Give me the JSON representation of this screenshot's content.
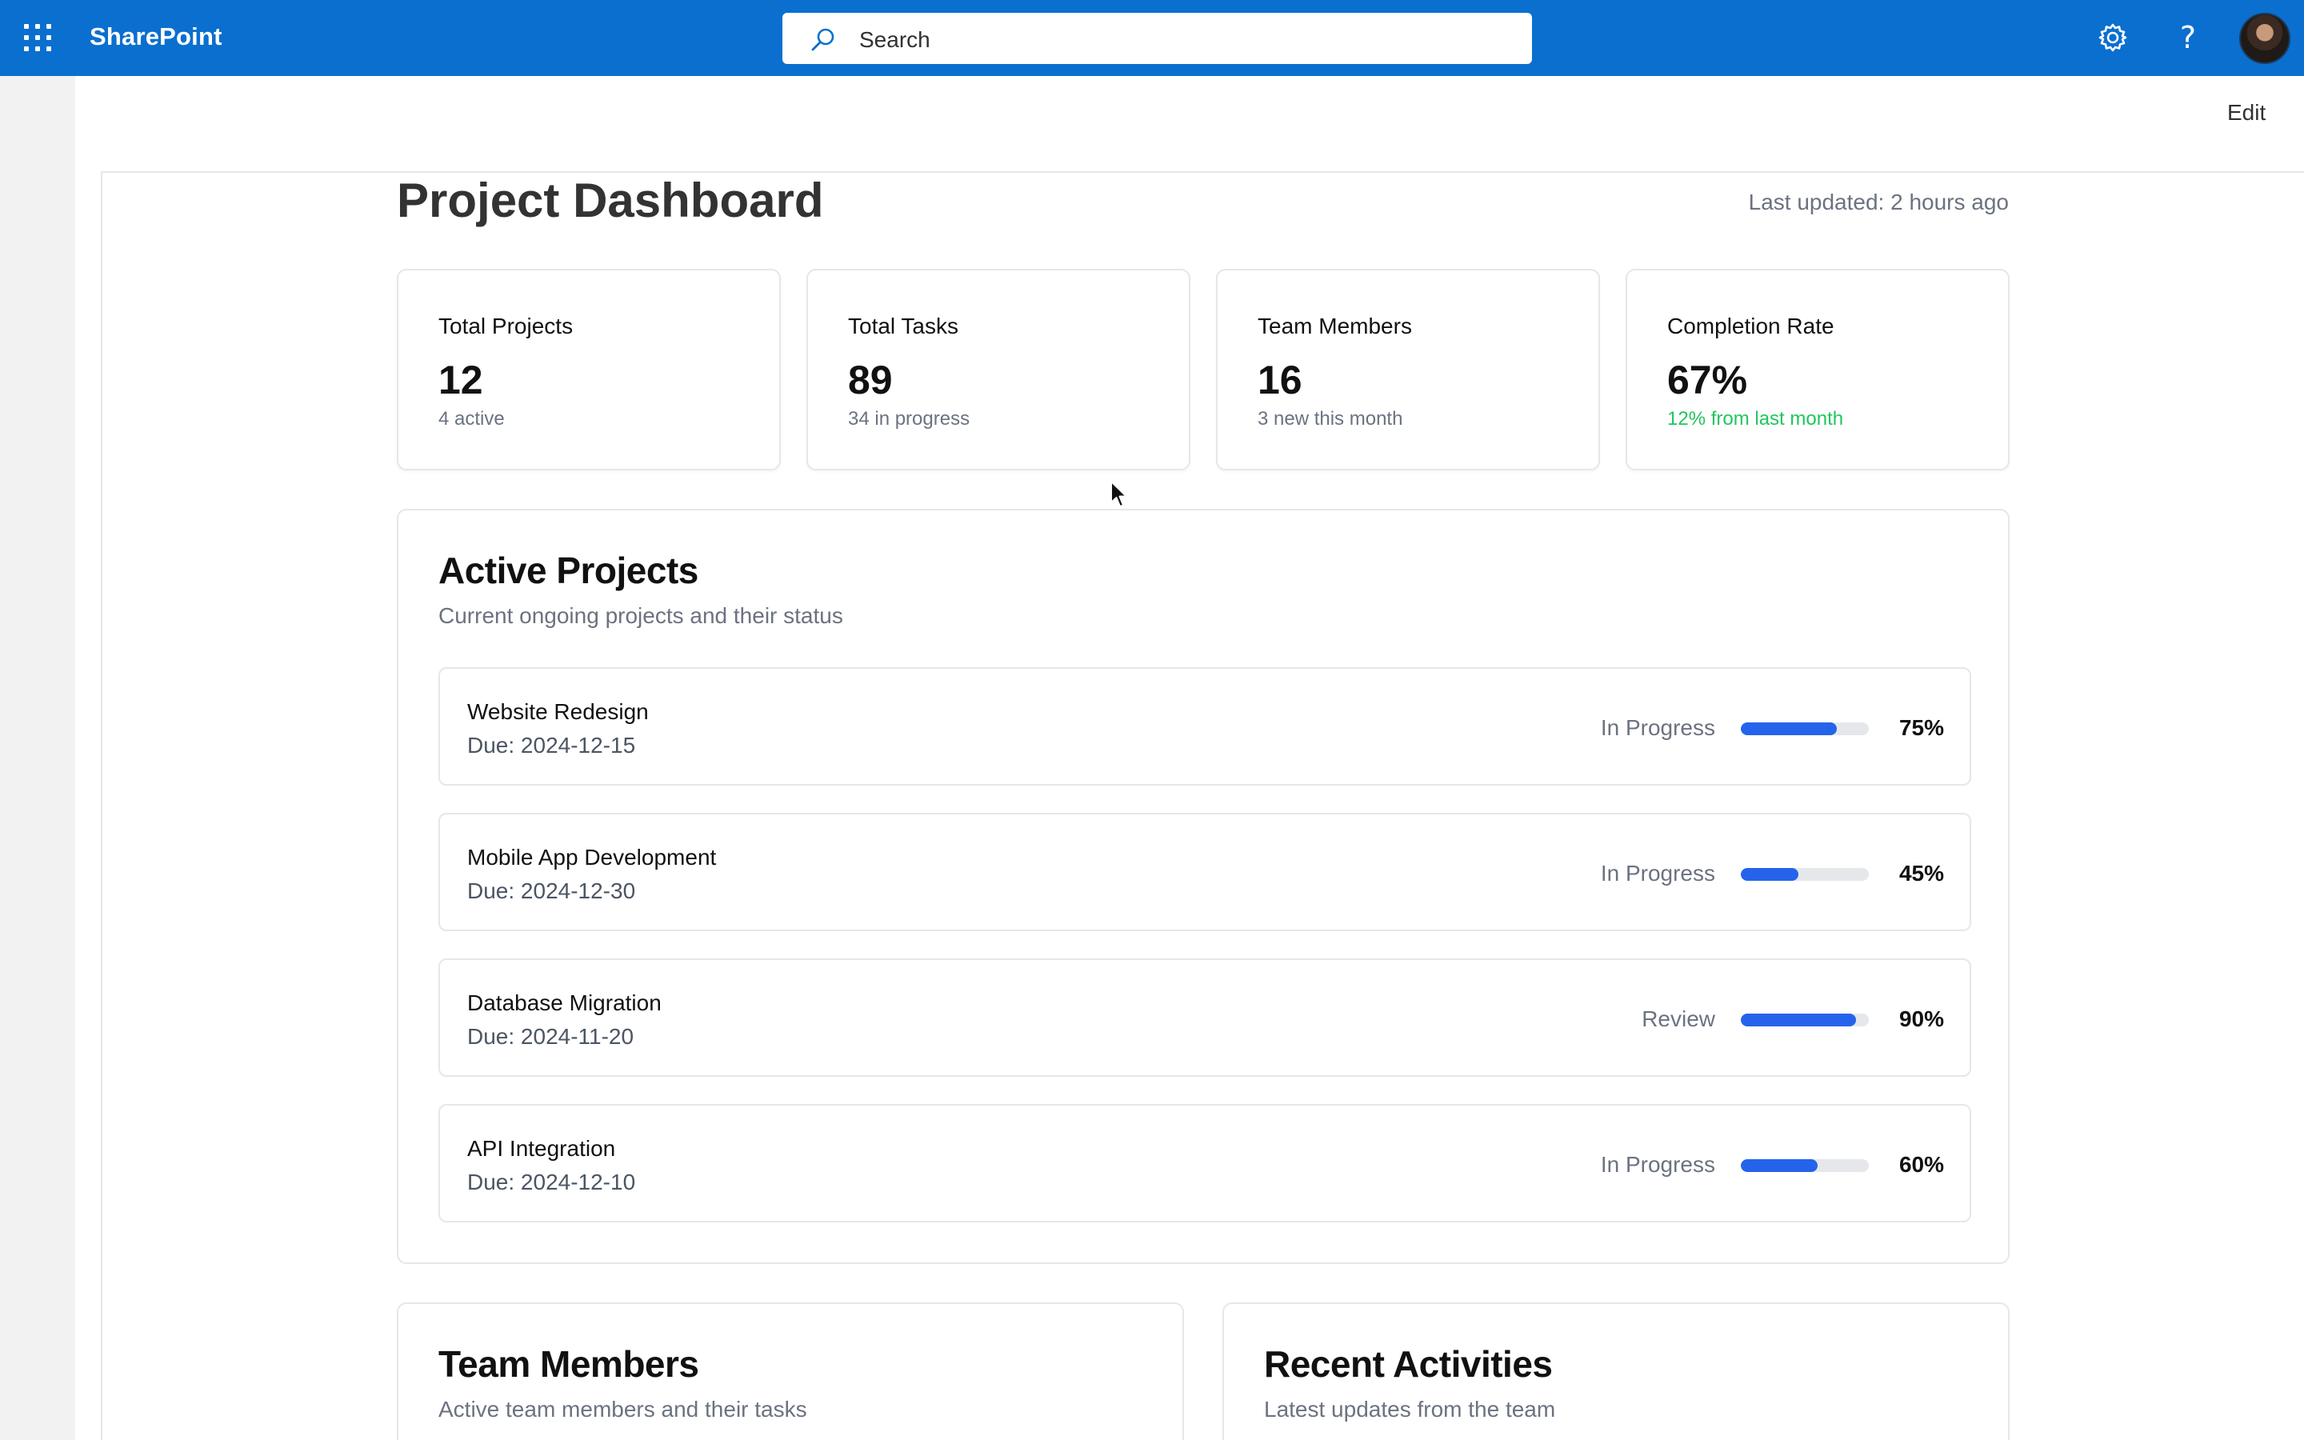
{
  "header": {
    "brand": "SharePoint",
    "search_placeholder": "Search",
    "help_glyph": "?",
    "icons": [
      "app-launcher-icon",
      "search-icon",
      "gear-icon",
      "help-icon"
    ],
    "accent_color": "#0a6fcf"
  },
  "page": {
    "edit_label": "Edit",
    "title": "Project Dashboard",
    "last_updated": "Last updated: 2 hours ago"
  },
  "stats": [
    {
      "label": "Total Projects",
      "value": "12",
      "sub": "4 active"
    },
    {
      "label": "Total Tasks",
      "value": "89",
      "sub": "34 in progress"
    },
    {
      "label": "Team Members",
      "value": "16",
      "sub": "3 new this month"
    },
    {
      "label": "Completion Rate",
      "value": "67%",
      "sub": "12% from last month",
      "sub_color": "#22c55e"
    }
  ],
  "active_projects": {
    "title": "Active Projects",
    "description": "Current ongoing projects and their status",
    "progress_color": "#2563eb",
    "items": [
      {
        "name": "Website Redesign",
        "due": "Due: 2024-12-15",
        "status": "In Progress",
        "progress": 75,
        "progress_label": "75%"
      },
      {
        "name": "Mobile App Development",
        "due": "Due: 2024-12-30",
        "status": "In Progress",
        "progress": 45,
        "progress_label": "45%"
      },
      {
        "name": "Database Migration",
        "due": "Due: 2024-11-20",
        "status": "Review",
        "progress": 90,
        "progress_label": "90%"
      },
      {
        "name": "API Integration",
        "due": "Due: 2024-12-10",
        "status": "In Progress",
        "progress": 60,
        "progress_label": "60%"
      }
    ]
  },
  "team_members": {
    "title": "Team Members",
    "description": "Active team members and their tasks"
  },
  "recent_activities": {
    "title": "Recent Activities",
    "description": "Latest updates from the team"
  }
}
